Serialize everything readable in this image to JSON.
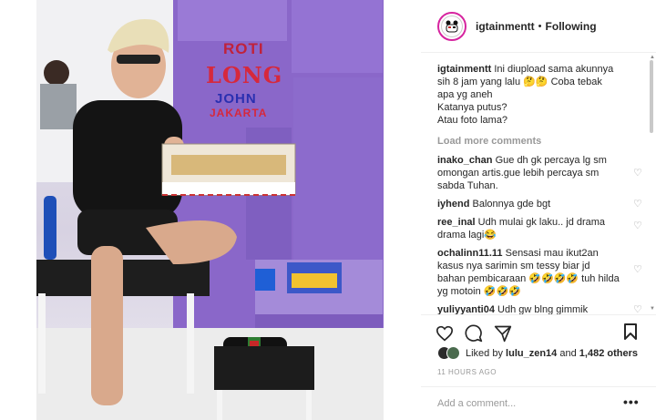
{
  "photo": {
    "overlay": {
      "roti": "ROTI",
      "long": "LONG",
      "john": "JOHN",
      "jakarta": "JAKARTA"
    }
  },
  "header": {
    "username": "igtainmentt",
    "separator": "•",
    "follow_status": "Following"
  },
  "caption": {
    "username": "igtainmentt",
    "text_line1": "Ini diupload sama akunnya sih 8 jam yang lalu 🤔🤔 Coba tebak apa yg aneh",
    "text_line2": "Katanya putus?",
    "text_line3": "Atau foto lama?"
  },
  "load_more": "Load more comments",
  "comments": [
    {
      "username": "inako_chan",
      "text": "Gue dh gk percaya lg sm omongan artis.gue lebih percaya sm sabda Tuhan."
    },
    {
      "username": "iyhend",
      "text": "Balonnya gde bgt"
    },
    {
      "username": "ree_inal",
      "text": "Udh mulai gk laku.. jd drama drama lagi😂"
    },
    {
      "username": "ochalinn11.11",
      "text": "Sensasi mau ikut2an kasus nya sarimin sm tessy biar jd bahan pembicaraan 🤣🤣🤣🤣 tuh hilda yg motoin 🤣🤣🤣"
    },
    {
      "username": "yuliyyanti04",
      "text": "Udh gw blng gimmik"
    }
  ],
  "likes": {
    "prefix": "Liked by",
    "user": "lulu_zen14",
    "connector": "and",
    "others": "1,482 others"
  },
  "timestamp": "11 HOURS AGO",
  "add_comment": {
    "placeholder": "Add a comment..."
  },
  "more_options": "•••",
  "icons": {
    "heart": "heart-icon",
    "comment": "comment-icon",
    "share": "share-icon",
    "bookmark": "bookmark-icon",
    "comment_like": "heart-outline-icon"
  }
}
